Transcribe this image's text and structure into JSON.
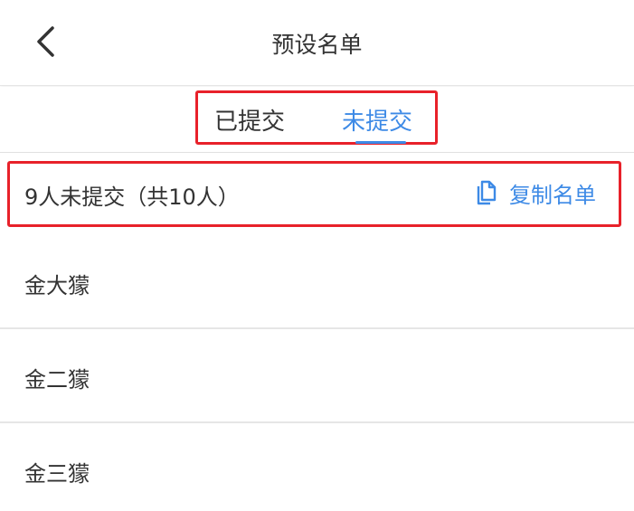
{
  "header": {
    "title": "预设名单",
    "back_icon": "chevron-left-icon"
  },
  "tabs": {
    "submitted_label": "已提交",
    "unsubmitted_label": "未提交",
    "active": "unsubmitted",
    "active_color": "#3d8ae6",
    "inactive_color": "#333333"
  },
  "summary": {
    "text": "9人未提交（共10人）",
    "copy_label": "复制名单",
    "copy_icon": "copy-icon"
  },
  "list": {
    "items": [
      {
        "name": "金大獴"
      },
      {
        "name": "金二獴"
      },
      {
        "name": "金三獴"
      }
    ]
  },
  "colors": {
    "accent": "#3d8ae6",
    "highlight_frame": "#e8212a",
    "divider": "#e6e6e6"
  }
}
